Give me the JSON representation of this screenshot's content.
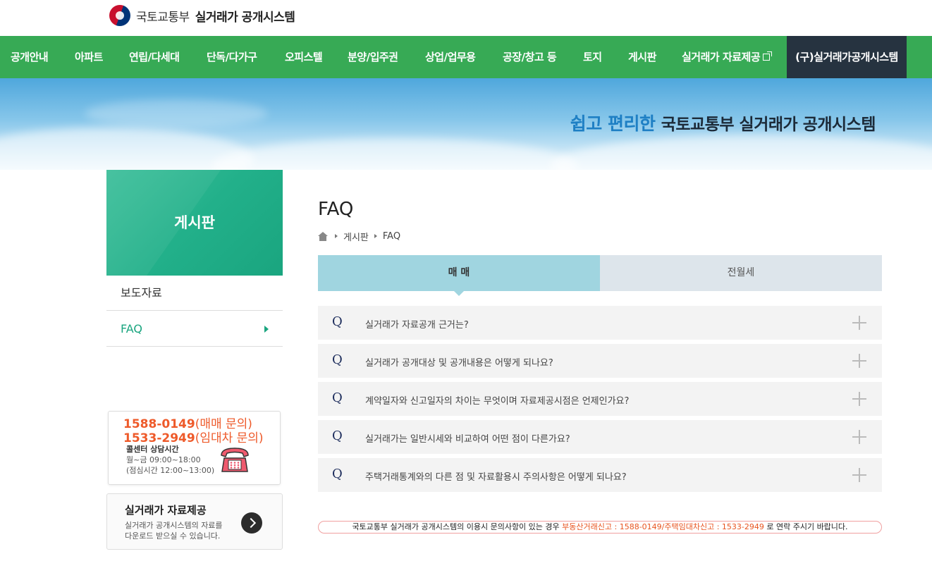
{
  "header": {
    "ministry": "국토교통부",
    "system": "실거래가 공개시스템"
  },
  "nav": {
    "items": [
      "공개안내",
      "아파트",
      "연립/다세대",
      "단독/다가구",
      "오피스텔",
      "분양/입주권",
      "상업/업무용",
      "공장/창고 등",
      "토지",
      "게시판",
      "실거래가 자료제공"
    ],
    "old_system": "(구)실거래가공개시스템"
  },
  "banner": {
    "highlight": "쉽고 편리한",
    "main": "국토교통부 실거래가 공개시스템"
  },
  "sidebar": {
    "title": "게시판",
    "items": [
      "보도자료",
      "FAQ"
    ],
    "callcenter": {
      "phone1": "1588-0149",
      "phone1_label": "(매매 문의)",
      "phone2": "1533-2949",
      "phone2_label": "(임대차 문의)",
      "hours_label": "콜센터 상담시간",
      "hours": "월~금  09:00~18:00",
      "lunch": "(점심시간 12:00~13:00)"
    },
    "data_provision": {
      "title": "실거래가 자료제공",
      "desc": "실거래가 공개시스템의 자료를 다운로드 받으실 수 있습니다."
    }
  },
  "main": {
    "title": "FAQ",
    "breadcrumb": [
      "게시판",
      "FAQ"
    ],
    "tabs": [
      "매 매",
      "전월세"
    ],
    "faq_marker": "Q",
    "faqs": [
      "실거래가 자료공개 근거는?",
      "실거래가 공개대상 및 공개내용은 어떻게 되나요?",
      "계약일자와 신고일자의 차이는 무엇이며 자료제공시점은 언제인가요?",
      "실거래가는 일반시세와 비교하여 어떤 점이 다른가요?",
      "주택거래통계와의 다른 점 및 자료활용시 주의사항은 어떻게 되나요?"
    ],
    "notice": {
      "before": "국토교통부 실거래가 공개시스템의 이용시 문의사항이 있는 경우 ",
      "highlight": "부동산거래신고 : 1588-0149/주택임대차신고 : 1533-2949",
      "after": " 로 연락 주시기 바랍니다."
    }
  },
  "colors": {
    "nav_green": "#37aa55",
    "nav_dark": "#263340",
    "sidebar_green": "#1aa57f",
    "tab_active": "#a0d5e0",
    "tab_inactive": "#dde5eb",
    "accent_orange": "#e8541f",
    "banner_blue": "#1e7fc4"
  },
  "icons": {
    "logo": "government-emblem-icon",
    "home": "home-icon",
    "external": "external-link-icon",
    "phone": "telephone-icon",
    "next": "chevron-right-icon",
    "expand": "plus-icon"
  }
}
